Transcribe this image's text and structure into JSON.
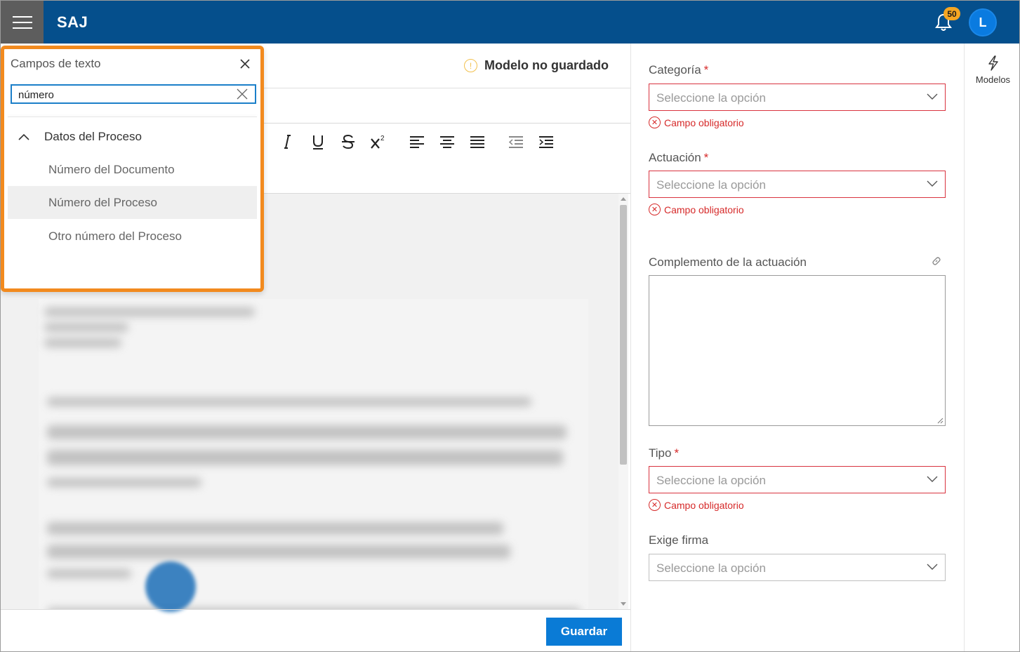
{
  "header": {
    "app_title": "SAJ",
    "notification_count": "50",
    "avatar_initial": "L",
    "brand_color": "#054f8c",
    "badge_color": "#f5a623",
    "icons": [
      "menu-icon",
      "bell-icon"
    ]
  },
  "editor": {
    "status_text": "Modelo no guardado",
    "status_icon": "info-icon",
    "toolbar": [
      "italic",
      "underline",
      "strikethrough",
      "superscript",
      "align-left",
      "align-center",
      "align-justify",
      "outdent",
      "indent"
    ],
    "save_label": "Guardar"
  },
  "text_fields_panel": {
    "title": "Campos de texto",
    "search_value": "número",
    "highlight_color": "#f28a1e",
    "group": {
      "label": "Datos del Proceso",
      "expanded": true,
      "items": [
        {
          "label": "Número del Documento"
        },
        {
          "label": "Número del Proceso",
          "hovered": true
        },
        {
          "label": "Otro número del Proceso"
        }
      ]
    }
  },
  "form": {
    "categoria": {
      "label": "Categoría",
      "required": "*",
      "placeholder": "Seleccione la opción",
      "error": "Campo obligatorio"
    },
    "actuacion": {
      "label": "Actuación",
      "required": "*",
      "placeholder": "Seleccione la opción",
      "error": "Campo obligatorio"
    },
    "complemento": {
      "label": "Complemento de la actuación"
    },
    "tipo": {
      "label": "Tipo",
      "required": "*",
      "placeholder": "Seleccione la opción",
      "error": "Campo obligatorio"
    },
    "exige_firma": {
      "label": "Exige firma",
      "placeholder": "Seleccione la opción"
    },
    "error_color": "#d62a2a"
  },
  "rail": {
    "modelos_label": "Modelos",
    "modelos_icon": "lightning-icon"
  }
}
